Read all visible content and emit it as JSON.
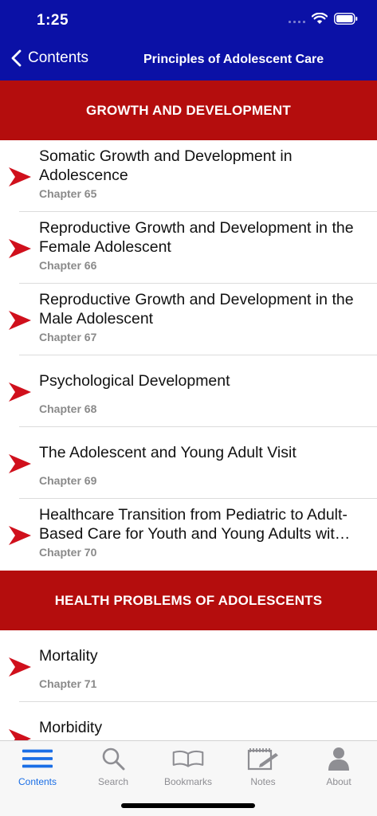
{
  "status": {
    "time": "1:25"
  },
  "nav": {
    "back_label": "Contents",
    "title": "Principles of Adolescent Care"
  },
  "sections": [
    {
      "title": "GROWTH AND DEVELOPMENT",
      "chapters": [
        {
          "title": "Somatic Growth and Development in Adolescence",
          "chapter": "Chapter 65"
        },
        {
          "title": "Reproductive Growth and Development in the Female Adolescent",
          "chapter": "Chapter 66"
        },
        {
          "title": "Reproductive Growth and Development in the Male Adolescent",
          "chapter": "Chapter 67"
        },
        {
          "title": "Psychological Development",
          "chapter": "Chapter 68"
        },
        {
          "title": "The Adolescent and Young Adult Visit",
          "chapter": "Chapter 69"
        },
        {
          "title": "Healthcare Transition from Pediatric to Adult-Based Care for Youth and Young Adults wit…",
          "chapter": "Chapter 70"
        }
      ]
    },
    {
      "title": "HEALTH PROBLEMS OF ADOLESCENTS",
      "chapters": [
        {
          "title": "Mortality",
          "chapter": "Chapter 71"
        },
        {
          "title": "Morbidity",
          "chapter": ""
        }
      ]
    }
  ],
  "tabs": [
    {
      "label": "Contents",
      "icon": "list-icon",
      "active": true
    },
    {
      "label": "Search",
      "icon": "search-icon",
      "active": false
    },
    {
      "label": "Bookmarks",
      "icon": "book-icon",
      "active": false
    },
    {
      "label": "Notes",
      "icon": "notepad-icon",
      "active": false
    },
    {
      "label": "About",
      "icon": "person-icon",
      "active": false
    }
  ],
  "colors": {
    "nav_bg": "#0b11a6",
    "section_bg": "#b40d0d",
    "arrow": "#d0101c",
    "tab_active": "#1a6ee6",
    "tab_inactive": "#8e8e93"
  }
}
